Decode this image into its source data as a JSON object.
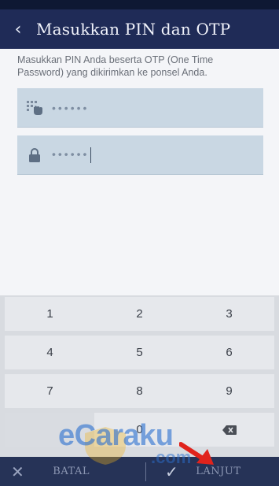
{
  "header": {
    "back_icon": "chevron-left-icon",
    "title": "Masukkan PIN dan OTP"
  },
  "instruction": "Masukkan PIN Anda beserta OTP (One Time Password) yang dikirimkan ke ponsel Anda.",
  "fields": {
    "pin": {
      "icon": "keypad-hand-icon",
      "value": "••••••"
    },
    "otp": {
      "icon": "lock-icon",
      "value": "••••••"
    }
  },
  "keypad": {
    "keys": [
      "1",
      "2",
      "3",
      "4",
      "5",
      "6",
      "7",
      "8",
      "9",
      "",
      "0",
      "⌫"
    ]
  },
  "bottom_bar": {
    "cancel_label": "BATAL",
    "next_label": "LANJUT"
  },
  "watermark": {
    "brand": "eCaraku",
    "suffix": ".com"
  },
  "colors": {
    "app_bar": "#1f2b57",
    "bottom_bar": "#263357",
    "field_bg": "#c9d7e3",
    "arrow": "#e0231c"
  }
}
